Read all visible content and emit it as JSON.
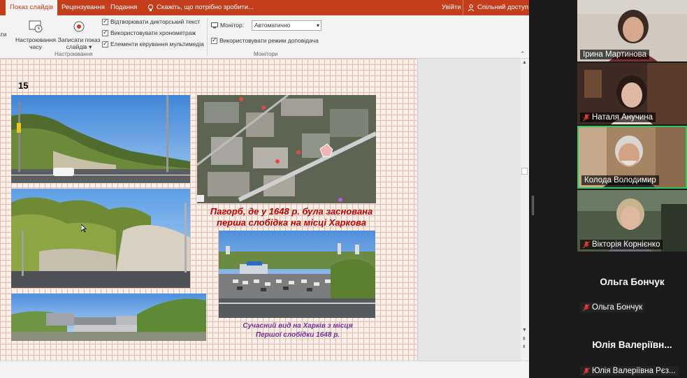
{
  "ribbon_tabs": {
    "slideshow": "Показ слайдів",
    "review": "Рецензування",
    "view": "Подання",
    "tell_me": "Скажіть, що потрібно зробити...",
    "signin": "Увійти",
    "share": "Спільний доступ"
  },
  "ribbon": {
    "btn_partial": "сати\nд",
    "btn_rehearse_line1": "Настроювання",
    "btn_rehearse_line2": "часу",
    "btn_record_line1": "Записати показ",
    "btn_record_line2": "слайдів",
    "check_narration": "Відтворювати дикторський текст",
    "check_timings": "Використовувати хронометраж",
    "check_media": "Елементи керування мультимедіа",
    "group_setup": "Настроювання",
    "monitor_label": "Монітор:",
    "monitor_value": "Автоматично",
    "check_presenter": "Використовувати режим доповідача",
    "group_monitors": "Монітори"
  },
  "slide": {
    "number": "15",
    "caption_main_line1": "Пагорб, де у 1648 р. була заснована",
    "caption_main_line2": "перша слобідка на місці Харкова",
    "caption_modern_line1": "Сучасний вид на Харків з місця",
    "caption_modern_line2": "Першої слобідки 1648 р."
  },
  "participants": [
    {
      "name": "Ірина Мартинова",
      "muted": false
    },
    {
      "name": "Наталя Анучина",
      "muted": true
    },
    {
      "name": "Колода Володимир",
      "muted": false
    },
    {
      "name": "Вікторія Корнієнко",
      "muted": true
    },
    {
      "name": "Ольга Бончук",
      "muted": true,
      "display": "Ольга Бончук"
    },
    {
      "name": "Юлія Валеріївна Рєз...",
      "muted": true,
      "display": "Юлія Валеріївн..."
    }
  ],
  "colors": {
    "ppt_accent": "#c43e1c",
    "caption_main": "#c00000",
    "caption_modern": "#7030a0",
    "active_speaker": "#35c759"
  }
}
